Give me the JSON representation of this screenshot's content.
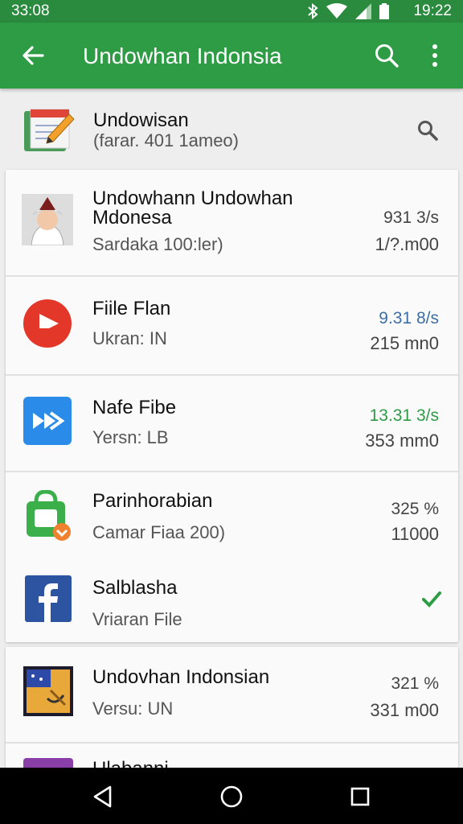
{
  "status_bar": {
    "time_left": "33:08",
    "time_right": "19:22"
  },
  "app_bar": {
    "title": "Undowhan Indonsia"
  },
  "header": {
    "name": "Undowisan",
    "subtitle": "(farar. 401 1ameo)"
  },
  "rows": [
    {
      "name": "Undowhann Undowhan Mdonesa",
      "sub": "Sardaka 100:ler)",
      "pct": "931 3/s",
      "size": "1/?.m00",
      "pct_color": "#444444"
    },
    {
      "name": "Fiile Flan",
      "sub": "Ukran: IN",
      "pct": "9.31 8/s",
      "size": "215 mn0",
      "pct_color": "#3d6fa6"
    },
    {
      "name": "Nafe Fibe",
      "sub": "Yersn: LB",
      "pct": "13.31 3/s",
      "size": "353 mm0",
      "pct_color": "#2e9b45"
    },
    {
      "name": "Parinhorabian",
      "sub": "Camar Fiaa 200)",
      "pct": "325 %",
      "size": "11000",
      "pct_color": "#444444"
    },
    {
      "name": "Salblasha",
      "sub": "Vriaran File",
      "pct": "",
      "size": "",
      "pct_color": "#444444"
    },
    {
      "name": "Undovhan Indonsian",
      "sub": "Versu: UN",
      "pct": "321 %",
      "size": "331 m00",
      "pct_color": "#444444"
    },
    {
      "name": "Ulabanni",
      "sub": "",
      "pct": "",
      "size": "",
      "pct_color": "#444444"
    }
  ],
  "icons": {
    "back": "arrow-left-icon",
    "search": "search-icon",
    "more": "more-vert-icon",
    "check": "check-icon"
  },
  "colors": {
    "primary": "#2e9b45",
    "status_bar": "#2a8a3e",
    "accent_check": "#2e9b45"
  }
}
